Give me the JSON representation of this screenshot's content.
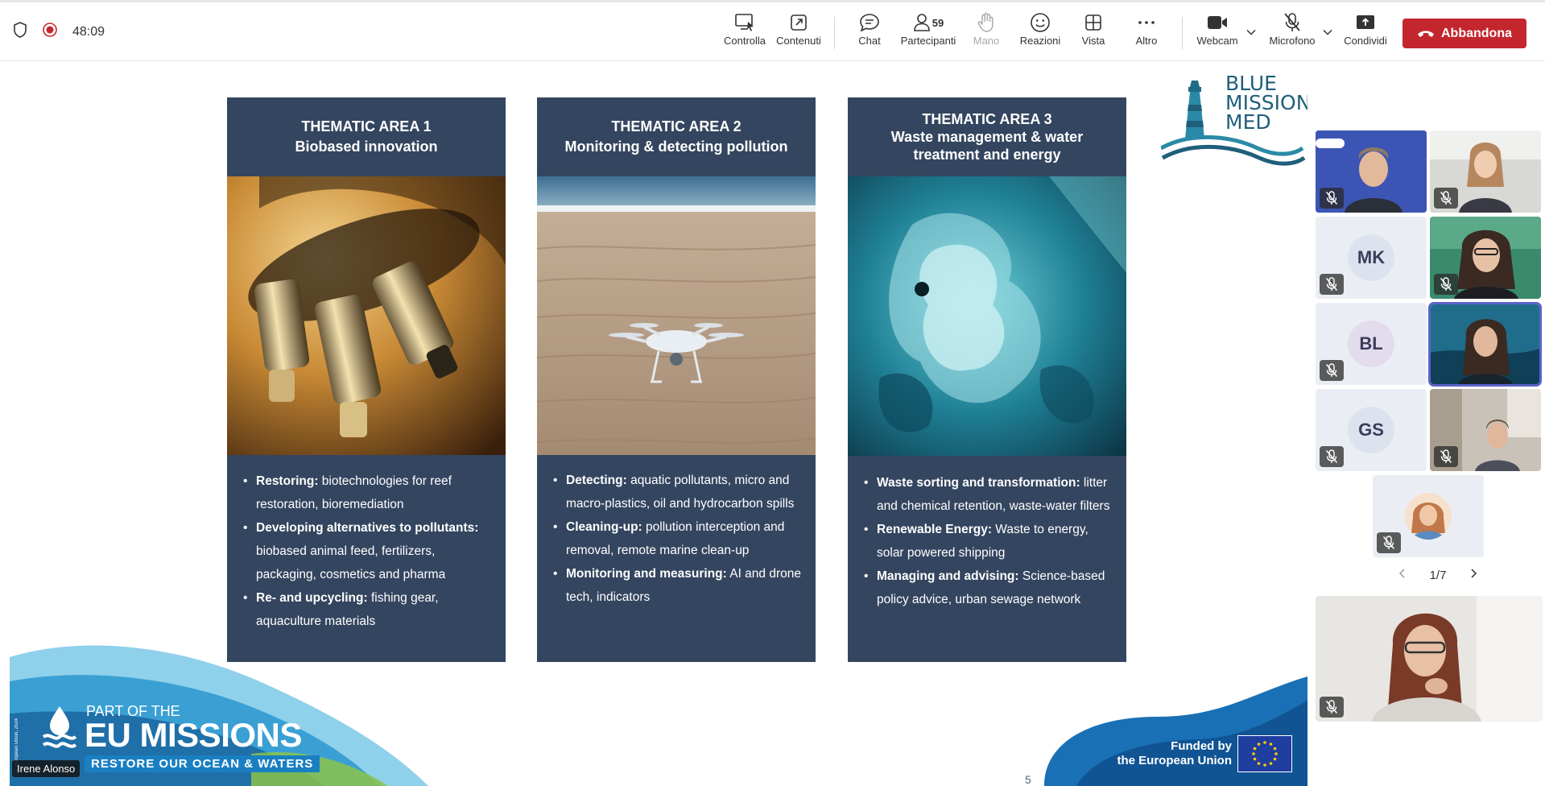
{
  "topbar": {
    "timer": "48:09",
    "buttons": {
      "controlla": "Controlla",
      "contenuti": "Contenuti",
      "chat": "Chat",
      "partecipanti": "Partecipanti",
      "participants_count": "59",
      "mano": "Mano",
      "reazioni": "Reazioni",
      "vista": "Vista",
      "altro": "Altro",
      "webcam": "Webcam",
      "microfono": "Microfono",
      "condividi": "Condividi",
      "abbandona": "Abbandona"
    },
    "colors": {
      "leave": "#c4262e"
    }
  },
  "slide": {
    "cards": [
      {
        "title": "THEMATIC AREA 1",
        "subtitle": "Biobased innovation",
        "image_icon": "microscope-image",
        "items": [
          {
            "bold": "Restoring:",
            "text": " biotechnologies for reef restoration, bioremediation"
          },
          {
            "bold": "Developing alternatives to pollutants:",
            "text": "  biobased animal feed, fertilizers, packaging, cosmetics and pharma"
          },
          {
            "bold": "Re- and upcycling:",
            "text": " fishing gear, aquaculture materials"
          }
        ]
      },
      {
        "title": "THEMATIC AREA 2",
        "subtitle": "Monitoring & detecting pollution",
        "image_icon": "drone-on-beach-image",
        "items": [
          {
            "bold": "Detecting:",
            "text": " aquatic pollutants, micro and macro-plastics, oil and hydrocarbon spills"
          },
          {
            "bold": "Cleaning-up:",
            "text": " pollution  interception and removal, remote marine clean-up"
          },
          {
            "bold": "Monitoring and measuring:",
            "text": " AI and drone tech, indicators"
          }
        ]
      },
      {
        "title": "THEMATIC AREA 3",
        "subtitle": "Waste management & water treatment and energy",
        "image_icon": "underwater-plastic-image",
        "items": [
          {
            "bold": "Waste sorting and transformation:",
            "text": " litter and chemical retention, waste-water filters"
          },
          {
            "bold": "Renewable Energy:",
            "text": " Waste to energy, solar powered shipping"
          },
          {
            "bold": "Managing and advising:",
            "text": " Science-based policy advice, urban sewage network"
          }
        ]
      }
    ],
    "logo": {
      "line1": "BLUE",
      "line2": "MISSION",
      "line3": "MED"
    },
    "eu": {
      "part_of": "PART OF THE",
      "missions": "EU MISSIONS",
      "restore": "RESTORE OUR OCEAN & WATERS",
      "copyright": "© European Union, 2024"
    },
    "funded": {
      "line1": "Funded by",
      "line2": "the European Union"
    },
    "page_number": "5",
    "speaker_name": "Irene Alonso",
    "colors": {
      "card_bg": "#34455f"
    }
  },
  "participants": {
    "tiles": [
      {
        "type": "video",
        "label": ""
      },
      {
        "type": "video",
        "label": ""
      },
      {
        "type": "avatar",
        "initials": "MK"
      },
      {
        "type": "video",
        "label": ""
      },
      {
        "type": "avatar",
        "initials": "BL"
      },
      {
        "type": "video",
        "label": ""
      },
      {
        "type": "avatar",
        "initials": "GS"
      },
      {
        "type": "video",
        "label": ""
      },
      {
        "type": "photo",
        "label": ""
      }
    ],
    "pager": "1/7"
  }
}
